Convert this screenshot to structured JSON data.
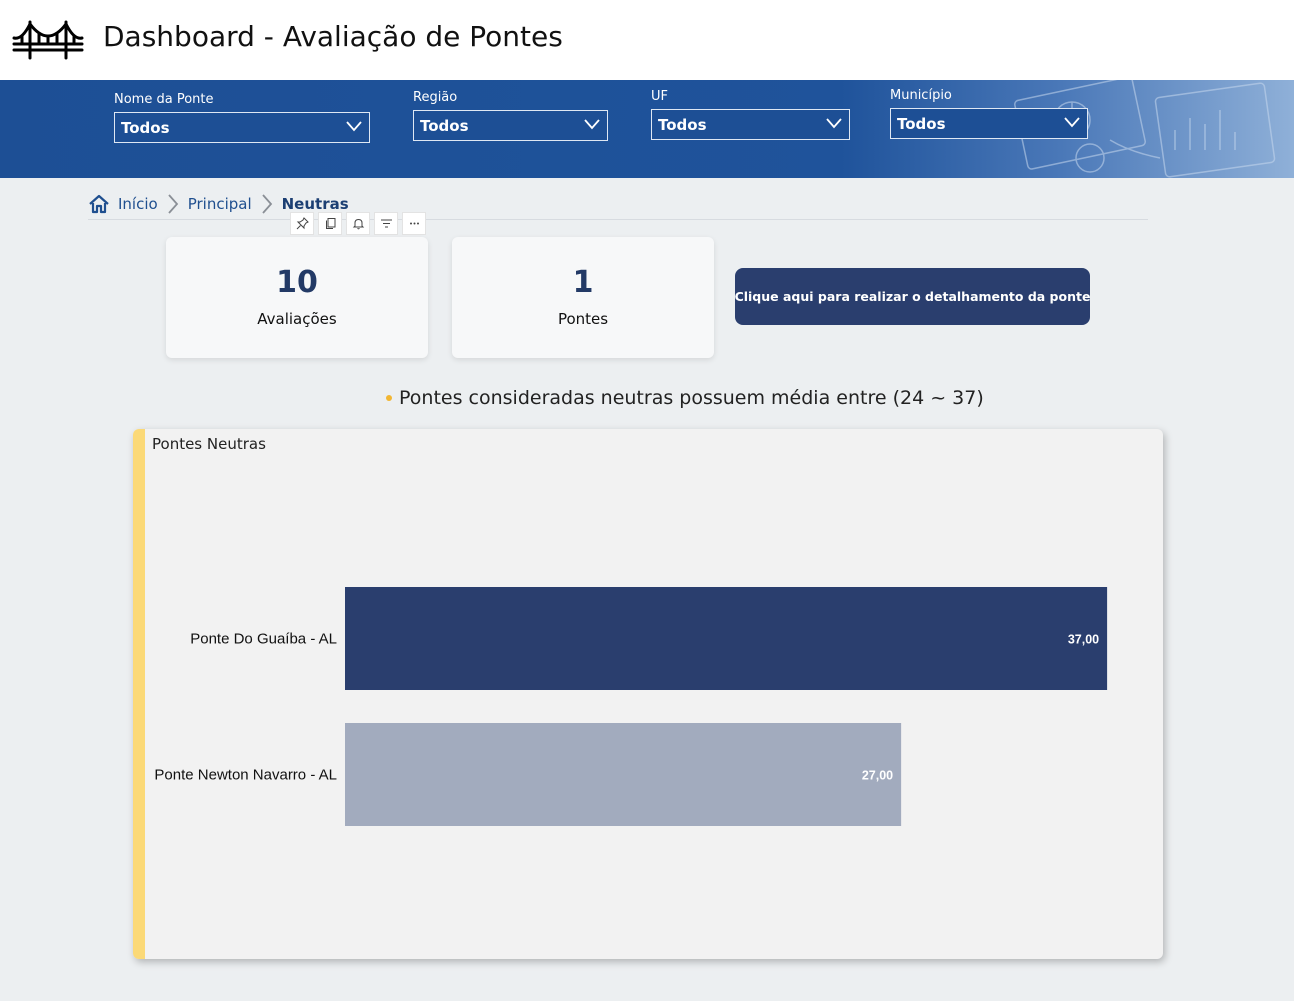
{
  "header": {
    "title": "Dashboard - Avaliação de Pontes",
    "logo_icon": "bridge-icon"
  },
  "filters": [
    {
      "label": "Nome da Ponte",
      "value": "Todos"
    },
    {
      "label": "Região",
      "value": "Todos"
    },
    {
      "label": "UF",
      "value": "Todos"
    },
    {
      "label": "Município",
      "value": "Todos"
    }
  ],
  "breadcrumb": {
    "home_icon": "home-icon",
    "items": [
      "Início",
      "Principal"
    ],
    "current": "Neutras"
  },
  "visual_toolbar": [
    "pin-icon",
    "copy-icon",
    "bell-icon",
    "filter-icon",
    "more-icon"
  ],
  "kpis": [
    {
      "value": "10",
      "label": "Avaliações"
    },
    {
      "value": "1",
      "label": "Pontes"
    }
  ],
  "detail_button": {
    "label": "Clique aqui para realizar o detalhamento da ponte"
  },
  "note": {
    "text": "Pontes consideradas neutras possuem média entre (24 ~ 37)"
  },
  "chart_data": {
    "type": "bar",
    "orientation": "horizontal",
    "title": "Pontes Neutras",
    "categories": [
      "Ponte Do Guaíba - AL",
      "Ponte Newton Navarro - AL"
    ],
    "values": [
      37,
      27
    ],
    "value_labels": [
      "37,00",
      "27,00"
    ],
    "bar_colors": [
      "#2a3e6e",
      "#a2abbe"
    ],
    "xlim": [
      0,
      38.5
    ],
    "grid": false,
    "legend": "none"
  },
  "colors": {
    "filter_bar": "#1d4f95",
    "primary_dark": "#2a3e6e",
    "accent": "#fbd977",
    "bullet": "#f2b632"
  }
}
